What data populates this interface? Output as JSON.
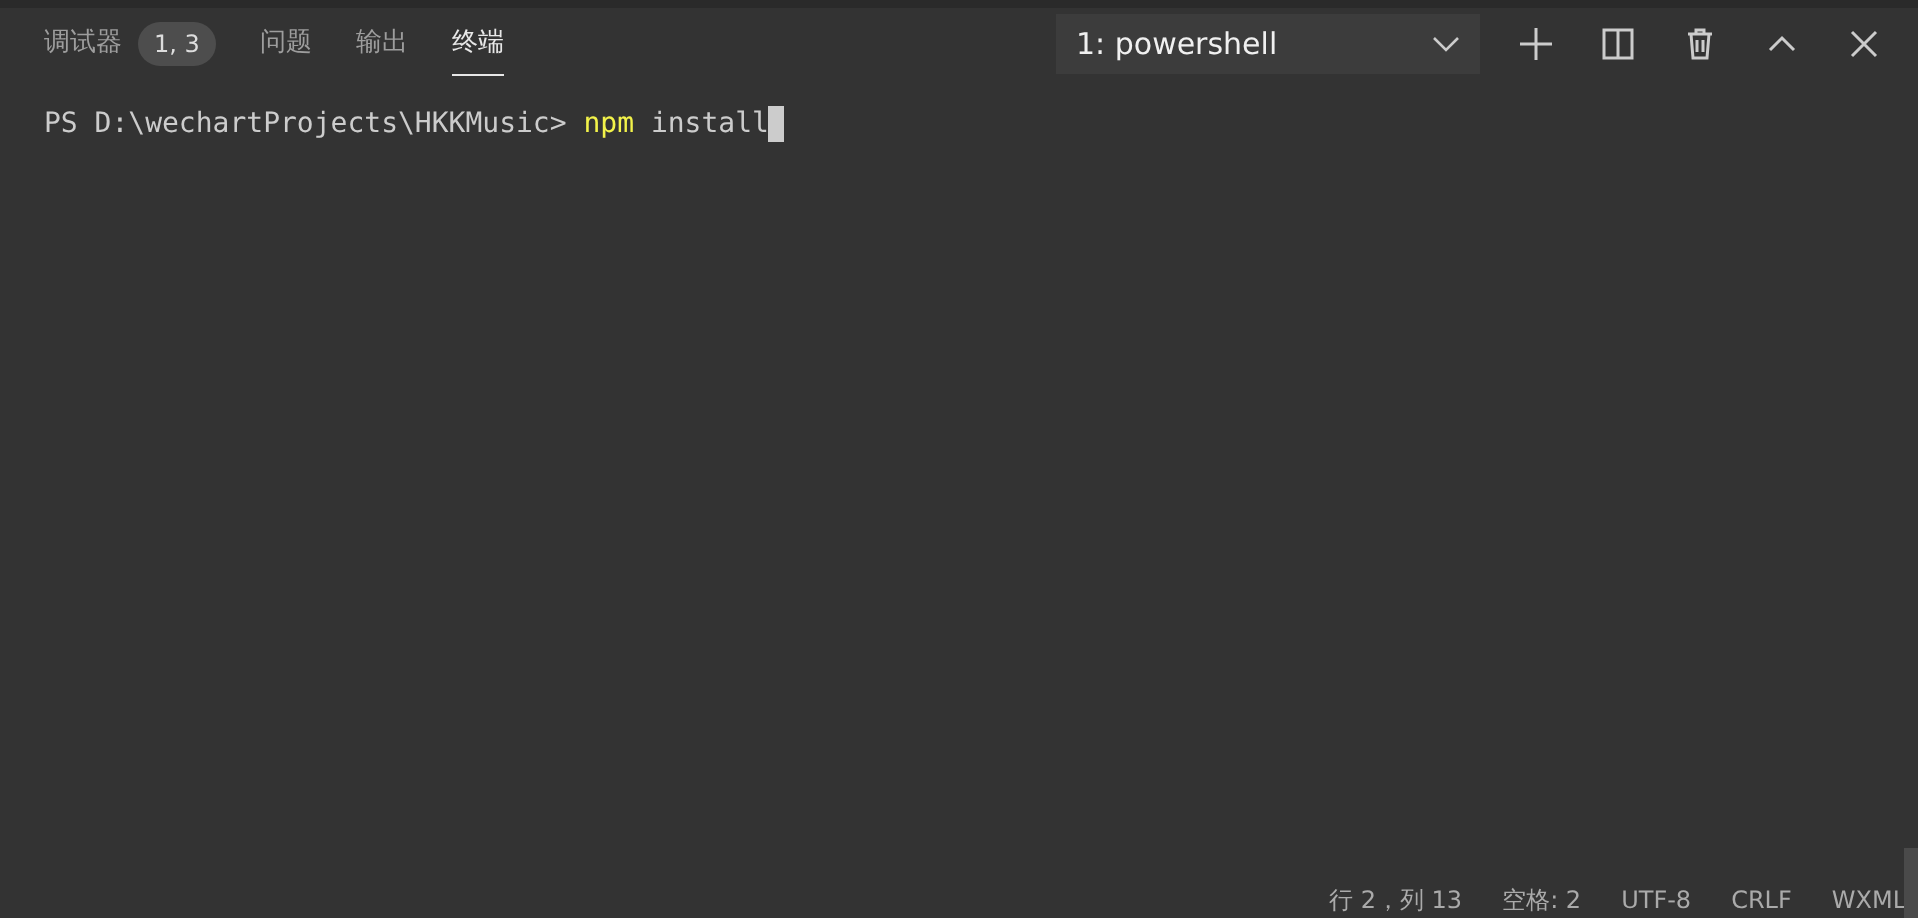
{
  "tabs": [
    {
      "label": "调试器",
      "badge": "1, 3",
      "selected": false
    },
    {
      "label": "问题",
      "selected": false
    },
    {
      "label": "输出",
      "selected": false
    },
    {
      "label": "终端",
      "selected": true
    }
  ],
  "terminal_picker": {
    "value": "1: powershell"
  },
  "toolbar": [
    {
      "kind": "add"
    },
    {
      "kind": "split"
    },
    {
      "kind": "trash"
    },
    {
      "kind": "maximize"
    },
    {
      "kind": "close"
    }
  ],
  "terminal": {
    "prompt": "PS D:\\wechartProjects\\HKKMusic> ",
    "command": "npm",
    "args": " install",
    "cursor": true
  },
  "status_bar": [
    "行 2，列 13",
    "空格: 2",
    "UTF-8",
    "CRLF",
    "WXML"
  ]
}
